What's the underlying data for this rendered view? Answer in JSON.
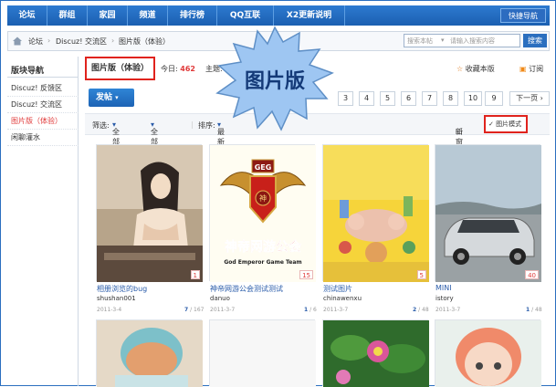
{
  "nav": {
    "items": [
      "论坛",
      "群组",
      "家园",
      "频道",
      "排行榜",
      "QQ互联",
      "X2更新说明"
    ],
    "quick": "快捷导航"
  },
  "breadcrumb": {
    "items": [
      "论坛",
      "Discuz! 交流区",
      "图片版（体验）"
    ]
  },
  "search": {
    "placeholder": "搜索本帖",
    "input": "请输入搜索内容",
    "button": "搜索"
  },
  "sidebar": {
    "title": "版块导航",
    "items": [
      "Discuz! 反馈区",
      "Discuz! 交流区",
      "图片版（体验）",
      "闲聊灌水"
    ]
  },
  "forum": {
    "title": "图片版（体验）",
    "today_label": "今日:",
    "today_value": "462",
    "topic_label": "主题:",
    "topic_value": "248",
    "favorite": "收藏本版",
    "subscribe": "订阅"
  },
  "badge": {
    "text": "图片版"
  },
  "toolbar": {
    "post": "发帖"
  },
  "pager": {
    "pages": [
      "3",
      "4",
      "5",
      "6",
      "7",
      "8",
      "9",
      "10"
    ],
    "next": "下一页"
  },
  "filter": {
    "label": "筛选:",
    "all_topics": "全部主题",
    "all_time": "全部时间",
    "sort_label": "排序:",
    "latest": "最新发表",
    "newwin": "新窗",
    "picmode": "图片模式"
  },
  "cards": [
    {
      "title": "相册浏览的bug",
      "user": "shushan001",
      "date": "2011-3-4",
      "views": "7",
      "replies": "167",
      "count": "1",
      "colors": [
        "#c9b59a",
        "#6d5a48",
        "#f3dfc8"
      ]
    },
    {
      "title": "神帝网游公会测试测试",
      "user": "danuo",
      "date": "2011-3-7",
      "views": "1",
      "replies": "6",
      "count": "15",
      "colors": [
        "#fffbe8",
        "#c82418",
        "#e9c070"
      ]
    },
    {
      "title": "测试图片",
      "user": "chinawenxu",
      "date": "2011-3-7",
      "views": "2",
      "replies": "48",
      "count": "5",
      "colors": [
        "#f5d63d",
        "#e9b7a3",
        "#8fc16d"
      ]
    },
    {
      "title": "MINI",
      "user": "istory",
      "date": "2011-3-7",
      "views": "1",
      "replies": "48",
      "count": "40",
      "colors": [
        "#9fb8c8",
        "#bfc5c9",
        "#4a5056"
      ]
    }
  ],
  "card2_text": {
    "title": "神帝网游公会",
    "sub": "God Emperor Game Team",
    "geg": "GEG",
    "seal": "神"
  }
}
